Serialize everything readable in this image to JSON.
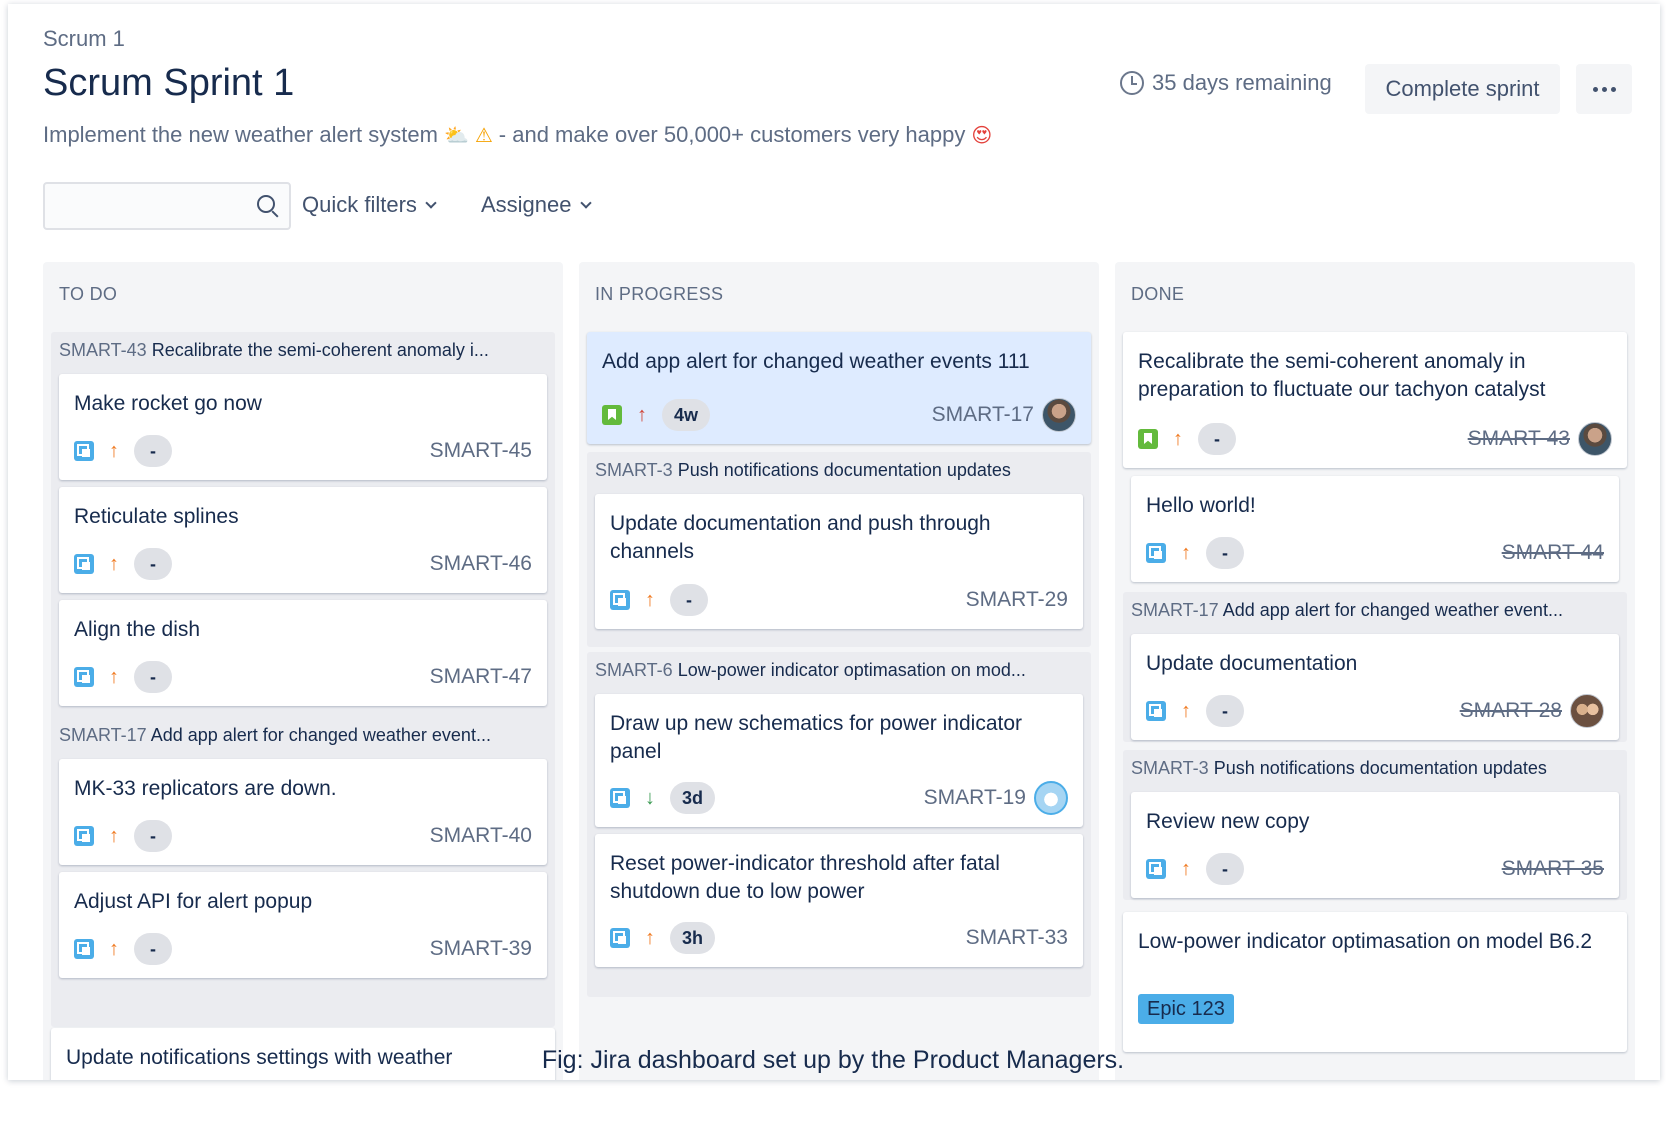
{
  "header": {
    "breadcrumb": "Scrum 1",
    "title": "Scrum Sprint 1",
    "goal_part1": "Implement the new weather alert system",
    "goal_part2": "- and make over 50,000+ customers very happy",
    "emoji_sun": "⛅",
    "emoji_warning": "⚠",
    "emoji_happy": "😍",
    "remaining": "35 days remaining",
    "complete_label": "Complete sprint"
  },
  "filters": {
    "search_placeholder": "",
    "quick_filters": "Quick filters",
    "assignee": "Assignee"
  },
  "columns": {
    "todo": "TO DO",
    "inprogress": "IN PROGRESS",
    "done": "DONE"
  },
  "todo": {
    "lane1": {
      "key": "SMART-43",
      "title": "Recalibrate the semi-coherent anomaly i..."
    },
    "c45": {
      "title": "Make rocket go now",
      "est": "-",
      "key": "SMART-45"
    },
    "c46": {
      "title": "Reticulate splines",
      "est": "-",
      "key": "SMART-46"
    },
    "c47": {
      "title": "Align the dish",
      "est": "-",
      "key": "SMART-47"
    },
    "lane2": {
      "key": "SMART-17",
      "title": "Add app alert for changed weather event..."
    },
    "c40": {
      "title": "MK-33 replicators are down.",
      "est": "-",
      "key": "SMART-40"
    },
    "c39": {
      "title": "Adjust API for alert popup",
      "est": "-",
      "key": "SMART-39"
    },
    "cpartial": {
      "title": "Update notifications settings with weather"
    }
  },
  "inprogress": {
    "c17": {
      "title": "Add app alert for changed weather events 111",
      "est": "4w",
      "key": "SMART-17"
    },
    "lane1": {
      "key": "SMART-3",
      "title": "Push notifications documentation updates"
    },
    "c29": {
      "title": "Update documentation and push through channels",
      "est": "-",
      "key": "SMART-29"
    },
    "lane2": {
      "key": "SMART-6",
      "title": "Low-power indicator optimasation on mod..."
    },
    "c19": {
      "title": "Draw up new schematics for power indicator panel",
      "est": "3d",
      "key": "SMART-19"
    },
    "c33": {
      "title": "Reset power-indicator threshold after fatal shutdown due to low power",
      "est": "3h",
      "key": "SMART-33"
    }
  },
  "done": {
    "c43": {
      "title": "Recalibrate the semi-coherent anomaly in preparation to fluctuate our tachyon catalyst",
      "est": "-",
      "key": "SMART-43"
    },
    "c44": {
      "title": "Hello world!",
      "est": "-",
      "key": "SMART-44"
    },
    "lane1": {
      "key": "SMART-17",
      "title": "Add app alert for changed weather event..."
    },
    "c28": {
      "title": "Update documentation",
      "est": "-",
      "key": "SMART-28"
    },
    "lane2": {
      "key": "SMART-3",
      "title": "Push notifications documentation updates"
    },
    "c35": {
      "title": "Review new copy",
      "est": "-",
      "key": "SMART-35"
    },
    "cepic": {
      "title": "Low-power indicator optimasation on model B6.2",
      "epic": "Epic 123"
    }
  },
  "caption": "Fig: Jira dashboard set up by the Product Managers.",
  "colors": {
    "accent_blue": "#4bade8",
    "story_green": "#63ba3c",
    "priority_orange": "#f07a21",
    "highlight": "#deebff"
  }
}
